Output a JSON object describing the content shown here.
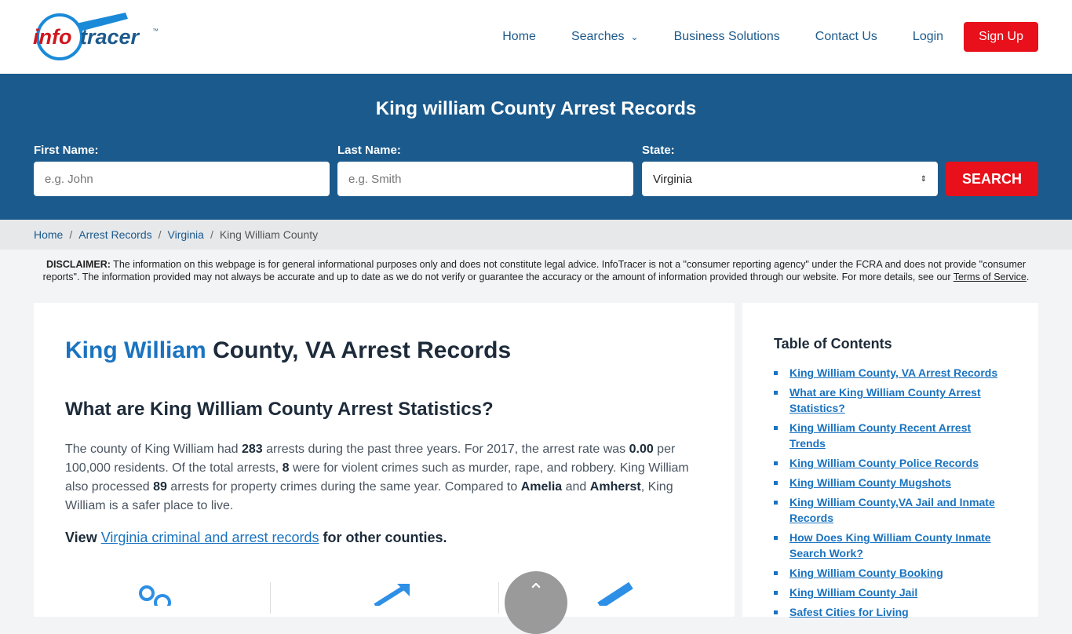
{
  "logo": {
    "text_info": "info",
    "text_tracer": "tracer",
    "tm": "™"
  },
  "nav": {
    "home": "Home",
    "searches": "Searches",
    "business": "Business Solutions",
    "contact": "Contact Us",
    "login": "Login",
    "signup": "Sign Up"
  },
  "hero": {
    "title": "King william County Arrest Records",
    "first_label": "First Name:",
    "first_placeholder": "e.g. John",
    "last_label": "Last Name:",
    "last_placeholder": "e.g. Smith",
    "state_label": "State:",
    "state_value": "Virginia",
    "search": "SEARCH"
  },
  "breadcrumb": [
    "Home",
    "Arrest Records",
    "Virginia",
    "King William County"
  ],
  "disclaimer": {
    "label": "DISCLAIMER:",
    "text": " The information on this webpage is for general informational purposes only and does not constitute legal advice. InfoTracer is not a \"consumer reporting agency\" under the FCRA and does not provide \"consumer reports\". The information provided may not always be accurate and up to date as we do not verify or guarantee the accuracy or the amount of information provided through our website. For more details, see our ",
    "link": "Terms of Service",
    "end": "."
  },
  "main": {
    "title_highlight": "King William",
    "title_rest": " County, VA Arrest Records",
    "subtitle": "What are King William County Arrest Statistics?",
    "p": [
      "The county of King William had ",
      "283",
      " arrests during the past three years. For 2017, the arrest rate was ",
      "0.00",
      " per 100,000 residents. Of the total arrests, ",
      "8",
      " were for violent crimes such as murder, rape, and robbery. King William also processed ",
      "89",
      " arrests for property crimes during the same year. Compared to ",
      "Amelia",
      " and ",
      "Amherst",
      ", King William is a safer place to live."
    ],
    "view_pre": "View ",
    "view_link": "Virginia criminal and arrest records",
    "view_post": " for other counties."
  },
  "toc": {
    "title": "Table of Contents",
    "items": [
      "King William County, VA Arrest Records",
      "What are King William County Arrest Statistics?",
      "King William County Recent Arrest Trends",
      "King William County Police Records",
      "King William County Mugshots",
      "King William County,VA Jail and Inmate Records",
      "How Does King William County Inmate Search Work?",
      "King William County Booking",
      "King William County Jail",
      "Safest Cities for Living"
    ]
  },
  "colors": {
    "brand_blue": "#1b5a8c",
    "accent_red": "#e8101a",
    "link": "#1a73c0"
  }
}
